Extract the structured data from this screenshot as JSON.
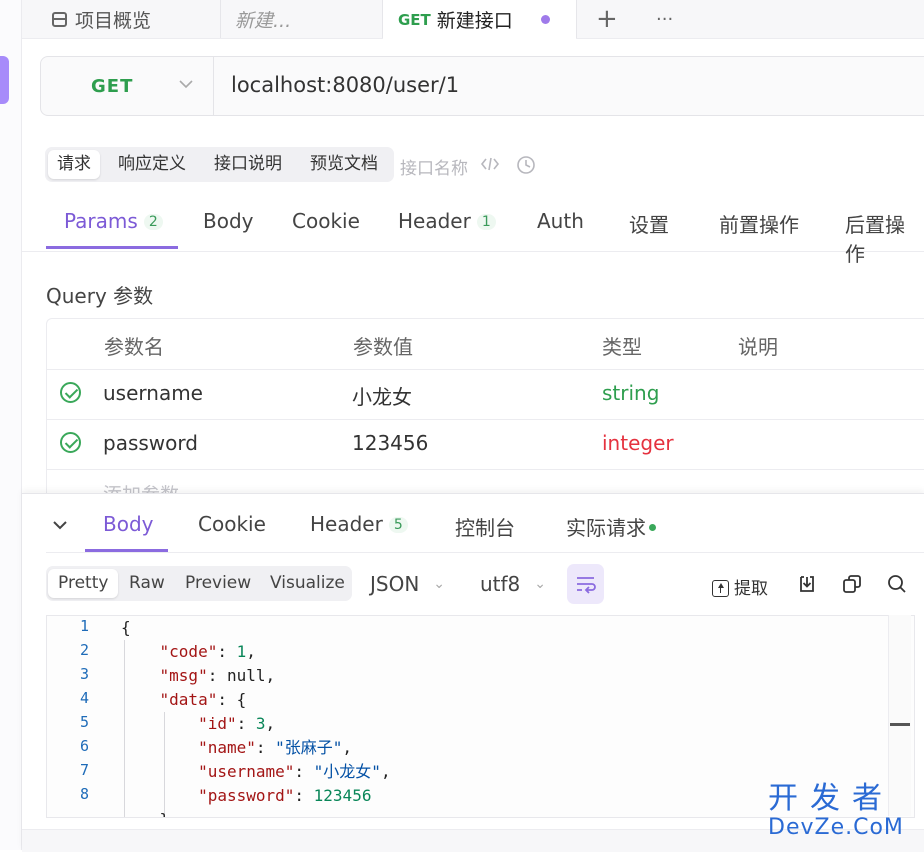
{
  "tabs": {
    "overview": "项目概览",
    "draft": "新建...",
    "active_method": "GET",
    "active_title": "新建接口",
    "add": "+",
    "more": "···"
  },
  "request": {
    "method": "GET",
    "url": "localhost:8080/user/1"
  },
  "doc_tabs": [
    "请求",
    "响应定义",
    "接口说明",
    "预览文档"
  ],
  "api_name_placeholder": "接口名称",
  "param_tabs": {
    "params": "Params",
    "params_count": "2",
    "body": "Body",
    "cookie": "Cookie",
    "header": "Header",
    "header_count": "1",
    "auth": "Auth",
    "settings": "设置",
    "pre": "前置操作",
    "post": "后置操作"
  },
  "query": {
    "title": "Query 参数",
    "headers": [
      "参数名",
      "参数值",
      "类型",
      "说明"
    ],
    "rows": [
      {
        "name": "username",
        "value": "小龙女",
        "type": "string"
      },
      {
        "name": "password",
        "value": "123456",
        "type": "integer"
      }
    ],
    "add_placeholder": "添加参数"
  },
  "response": {
    "tabs": {
      "body": "Body",
      "cookie": "Cookie",
      "header": "Header",
      "header_count": "5",
      "console": "控制台",
      "actual": "实际请求"
    },
    "formats": [
      "Pretty",
      "Raw",
      "Preview",
      "Visualize"
    ],
    "type": "JSON",
    "encoding": "utf8",
    "extract": "提取",
    "code_lines": [
      {
        "n": "1"
      },
      {
        "n": "2"
      },
      {
        "n": "3"
      },
      {
        "n": "4"
      },
      {
        "n": "5"
      },
      {
        "n": "6"
      },
      {
        "n": "7"
      },
      {
        "n": "8"
      }
    ],
    "json": {
      "code": "1",
      "msg": "null",
      "id": "3",
      "name": "\"张麻子\"",
      "username": "\"小龙女\"",
      "password": "123456"
    }
  },
  "colors": {
    "accent": "#8b6be0",
    "get": "#2e9e4e",
    "string": "#3aa85a",
    "integer": "#e5323f"
  },
  "watermark": {
    "line1": "开发者",
    "line2": "DevZe.CoM"
  }
}
